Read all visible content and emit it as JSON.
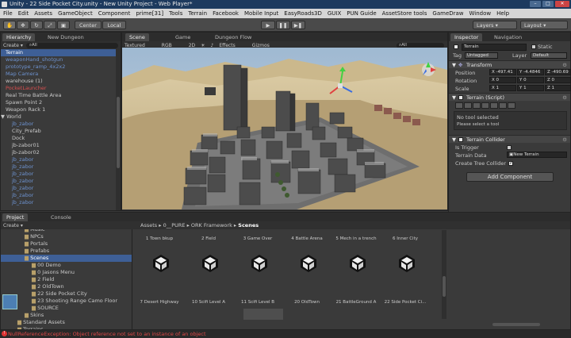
{
  "window": {
    "title": "Unity - 22 Side Pocket City.unity - New Unity Project - Web Player*",
    "min": "–",
    "max": "□",
    "close": "✕"
  },
  "menu": [
    "File",
    "Edit",
    "Assets",
    "GameObject",
    "Component",
    "prime[31]",
    "Tools",
    "Terrain",
    "Facebook",
    "Mobile Input",
    "EasyRoads3D",
    "GUIX",
    "PUN Guide",
    "AssetStore tools",
    "GameDraw",
    "Window",
    "Help"
  ],
  "toolbar": {
    "center": "Center",
    "local": "Local",
    "layers": "Layers",
    "layout": "Layout"
  },
  "hierarchy": {
    "tab": "Hierarchy",
    "tab2": "New Dungeon",
    "create": "Create ▾",
    "search": "All",
    "items": [
      {
        "label": "Terrain",
        "style": "sel",
        "indent": 0
      },
      {
        "label": "weaponHand_shotgun",
        "style": "blue",
        "indent": 0
      },
      {
        "label": "prototype_ramp_4x2x2",
        "style": "blue",
        "indent": 0
      },
      {
        "label": "Map Camera",
        "style": "blue",
        "indent": 0
      },
      {
        "label": "warehouse (1)",
        "style": "",
        "indent": 0
      },
      {
        "label": "PocketLauncher",
        "style": "red",
        "indent": 0
      },
      {
        "label": "Real Time Battle Area",
        "style": "",
        "indent": 0
      },
      {
        "label": "Spawn Point 2",
        "style": "",
        "indent": 0
      },
      {
        "label": "Weapon Rack 1",
        "style": "",
        "indent": 0
      },
      {
        "label": "World",
        "style": "",
        "indent": 0
      },
      {
        "label": "jb_zabor",
        "style": "blue",
        "indent": 1
      },
      {
        "label": "City_Prefab",
        "style": "",
        "indent": 1
      },
      {
        "label": "Dock",
        "style": "",
        "indent": 1
      },
      {
        "label": "jb-zabor01",
        "style": "",
        "indent": 1
      },
      {
        "label": "jb-zabor02",
        "style": "",
        "indent": 1
      },
      {
        "label": "jb_zabor",
        "style": "blue",
        "indent": 1
      },
      {
        "label": "jb_zabor",
        "style": "blue",
        "indent": 1
      },
      {
        "label": "jb_zabor",
        "style": "blue",
        "indent": 1
      },
      {
        "label": "jb_zabor",
        "style": "blue",
        "indent": 1
      },
      {
        "label": "jb_zabor",
        "style": "blue",
        "indent": 1
      },
      {
        "label": "jb_zabor",
        "style": "blue",
        "indent": 1
      },
      {
        "label": "jb_zabor",
        "style": "blue",
        "indent": 1
      }
    ]
  },
  "scene": {
    "tabs": [
      "Scene",
      "Game",
      "Dungeon Flow"
    ],
    "textured": "Textured",
    "rgb": "RGB",
    "mode2d": "2D",
    "effects": "Effects",
    "gizmos": "Gizmos",
    "search": "All"
  },
  "inspector": {
    "tabs": [
      "Inspector",
      "Navigation"
    ],
    "object_name": "Terrain",
    "static": "Static",
    "tag_label": "Tag",
    "tag_value": "Untagged",
    "layer_label": "Layer",
    "layer_value": "Default",
    "transform": {
      "title": "Transform",
      "position_label": "Position",
      "rotation_label": "Rotation",
      "scale_label": "Scale",
      "position": [
        "X -497.41",
        "Y -4.4846",
        "Z -490.69"
      ],
      "rotation": [
        "X 0",
        "Y 0",
        "Z 0"
      ],
      "scale": [
        "X 1",
        "Y 1",
        "Z 1"
      ]
    },
    "terrain_script": {
      "title": "Terrain (Script)",
      "no_tool": "No tool selected",
      "hint": "Please select a tool"
    },
    "terrain_collider": {
      "title": "Terrain Collider",
      "is_trigger": "Is Trigger",
      "terrain_data": "Terrain Data",
      "terrain_data_value": "New Terrain",
      "create_tree_collider": "Create Tree Collider"
    },
    "add_component": "Add Component"
  },
  "project": {
    "tabs": [
      "Project",
      "Console"
    ],
    "create": "Create ▾",
    "tree": [
      {
        "label": "Music",
        "indent": 3
      },
      {
        "label": "NPCs",
        "indent": 3
      },
      {
        "label": "Portals",
        "indent": 3
      },
      {
        "label": "Prefabs",
        "indent": 3
      },
      {
        "label": "Scenes",
        "indent": 3,
        "sel": true
      },
      {
        "label": "00 Demo",
        "indent": 4
      },
      {
        "label": "0 Jasons Menu",
        "indent": 4
      },
      {
        "label": "2 Field",
        "indent": 4
      },
      {
        "label": "2 OldTown",
        "indent": 4
      },
      {
        "label": "22 Side Pocket City",
        "indent": 4
      },
      {
        "label": "23 Shooting Range Camo Floor",
        "indent": 4
      },
      {
        "label": "SOURCE",
        "indent": 4
      },
      {
        "label": "Skins",
        "indent": 3
      },
      {
        "label": "Standard Assets",
        "indent": 2
      },
      {
        "label": "Terrains",
        "indent": 2
      }
    ],
    "breadcrumb": [
      "Assets",
      "0__PURE",
      "ORK Framework",
      "Scenes"
    ],
    "assets": [
      "1 Town bkup",
      "2 Field",
      "3 Game Over",
      "4 Battle Arena",
      "5 Mech in a trench",
      "6 Inner City",
      "7 Desert Highway",
      "10 Scifi Level A",
      "11 Scifi Level B",
      "20 OldTown",
      "21 BattleGround A",
      "22 Side Pocket Ci..."
    ]
  },
  "status": {
    "error": "NullReferenceException: Object reference not set to an instance of an object"
  },
  "colors": {
    "accent": "#3e5f96",
    "error": "#e04848",
    "terrain_sand": "#c9b48a",
    "sky": "#a9bfd3"
  }
}
